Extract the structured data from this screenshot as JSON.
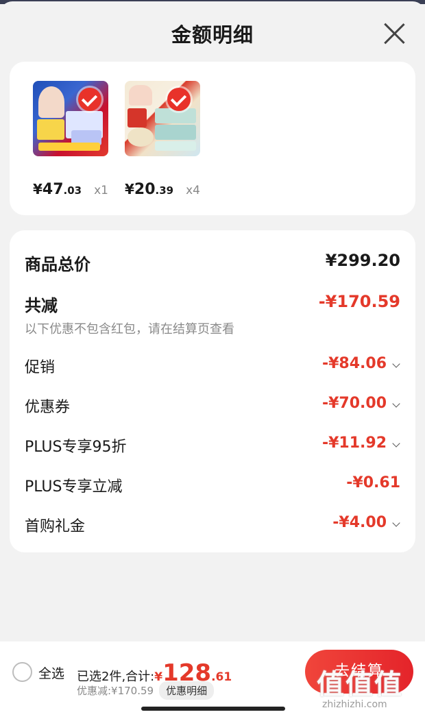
{
  "header": {
    "title": "金额明细"
  },
  "products": [
    {
      "price_currency": "¥",
      "price_int": "47",
      "price_dec": ".03",
      "qty": "x1"
    },
    {
      "price_currency": "¥",
      "price_int": "20",
      "price_dec": ".39",
      "qty": "x4"
    }
  ],
  "summary": {
    "total_label": "商品总价",
    "total_value": "¥299.20",
    "reduced_label": "共减",
    "reduced_value": "-¥170.59",
    "note": "以下优惠不包含红包，请在结算页查看",
    "items": [
      {
        "label": "促销",
        "value": "-¥84.06",
        "expandable": true
      },
      {
        "label": "优惠券",
        "value": "-¥70.00",
        "expandable": true
      },
      {
        "label": "PLUS专享95折",
        "value": "-¥11.92",
        "expandable": true
      },
      {
        "label": "PLUS专享立减",
        "value": "-¥0.61",
        "expandable": false
      },
      {
        "label": "首购礼金",
        "value": "-¥4.00",
        "expandable": true
      }
    ]
  },
  "bottom": {
    "select_all": "全选",
    "selected_text": "已选2件,合计:",
    "total_currency": "¥",
    "total_int": "128",
    "total_dec": ".61",
    "discount_text": "优惠减:¥170.59",
    "detail_button": "优惠明细",
    "checkout_button": "去结算"
  },
  "watermark": {
    "text": "值值值",
    "url": "zhizhizhi.com"
  },
  "colors": {
    "accent": "#e4392a",
    "background": "#f2f2f2",
    "card": "#ffffff"
  }
}
